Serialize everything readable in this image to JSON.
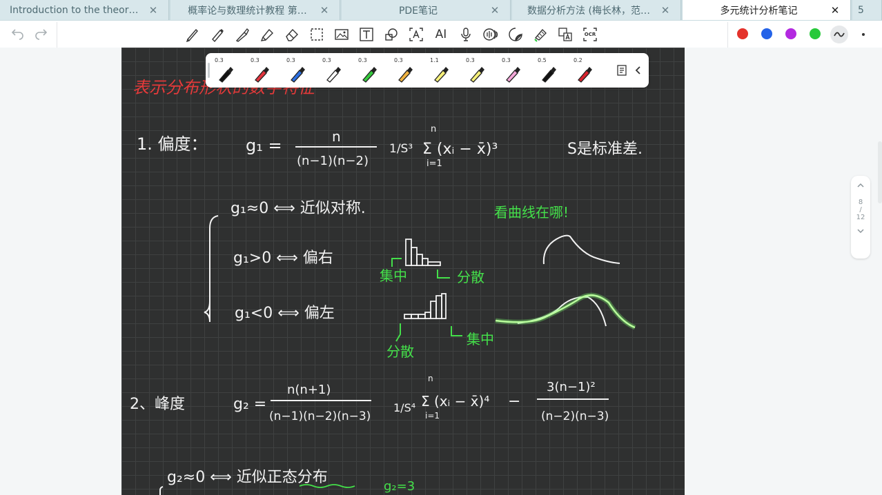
{
  "tabs": [
    {
      "label": "Introduction to the theory…",
      "active": false
    },
    {
      "label": "概率论与数理统计教程 第…",
      "active": false
    },
    {
      "label": "PDE笔记",
      "active": false
    },
    {
      "label": "数据分析方法 (梅长林，范…",
      "active": false
    },
    {
      "label": "多元统计分析笔记",
      "active": true
    }
  ],
  "tab_overflow_count": "5",
  "toolbar": {
    "text_tool_label": "AI",
    "ocr_label": "OCR",
    "colors": [
      "#e4322b",
      "#2463e8",
      "#b32ae0",
      "#27c93a"
    ]
  },
  "pens": [
    {
      "size": "0.3",
      "color": "#111111"
    },
    {
      "size": "0.3",
      "color": "#e2343d"
    },
    {
      "size": "0.3",
      "color": "#2c6fe0"
    },
    {
      "size": "0.3",
      "color": "#ffffff"
    },
    {
      "size": "0.3",
      "color": "#35c93d"
    },
    {
      "size": "0.3",
      "color": "#f0b340"
    },
    {
      "size": "1.1",
      "color": "#f6f07a"
    },
    {
      "size": "0.3",
      "color": "#f6f07a"
    },
    {
      "size": "0.3",
      "color": "#f2a7d8"
    },
    {
      "size": "0.5",
      "color": "#111111"
    },
    {
      "size": "0.2",
      "color": "#d8232e"
    }
  ],
  "pager": {
    "current": "8",
    "sep": "/",
    "total": "12"
  },
  "notes": {
    "heading": "表示分布形状的数字特征",
    "item1_label": "1. 偏度：",
    "item1_formula_lhs": "g₁ =",
    "item1_num": "n",
    "item1_den": "(n−1)(n−2)",
    "item1_s3": "1/S³",
    "item1_sum": "Σ (xᵢ − x̄)³",
    "item1_sum_top": "n",
    "item1_sum_bottom": "i=1",
    "item1_note": "S是标准差.",
    "case_sym": "g₁≈0 ⟺ 近似对称.",
    "case_pos": "g₁>0 ⟺ 偏右",
    "case_neg": "g₁<0 ⟺ 偏左",
    "green_q": "看曲线在哪!",
    "green_jizhong1": "集中",
    "green_fensan1": "分散",
    "green_fensan2": "分散",
    "green_jizhong2": "集中",
    "item2_label": "2、峰度",
    "item2_lhs": "g₂ =",
    "item2_num": "n(n+1)",
    "item2_den": "(n−1)(n−2)(n−3)",
    "item2_s4": "1/S⁴",
    "item2_sum": "Σ (xᵢ − x̄)⁴",
    "item2_sum_top": "n",
    "item2_sum_bottom": "i=1",
    "item2_minus": "−",
    "item2_num2": "3(n−1)²",
    "item2_den2": "(n−2)(n−3)",
    "case_g2": "g₂≈0 ⟺ 近似正态分布",
    "green_g2": "g₂=3"
  }
}
